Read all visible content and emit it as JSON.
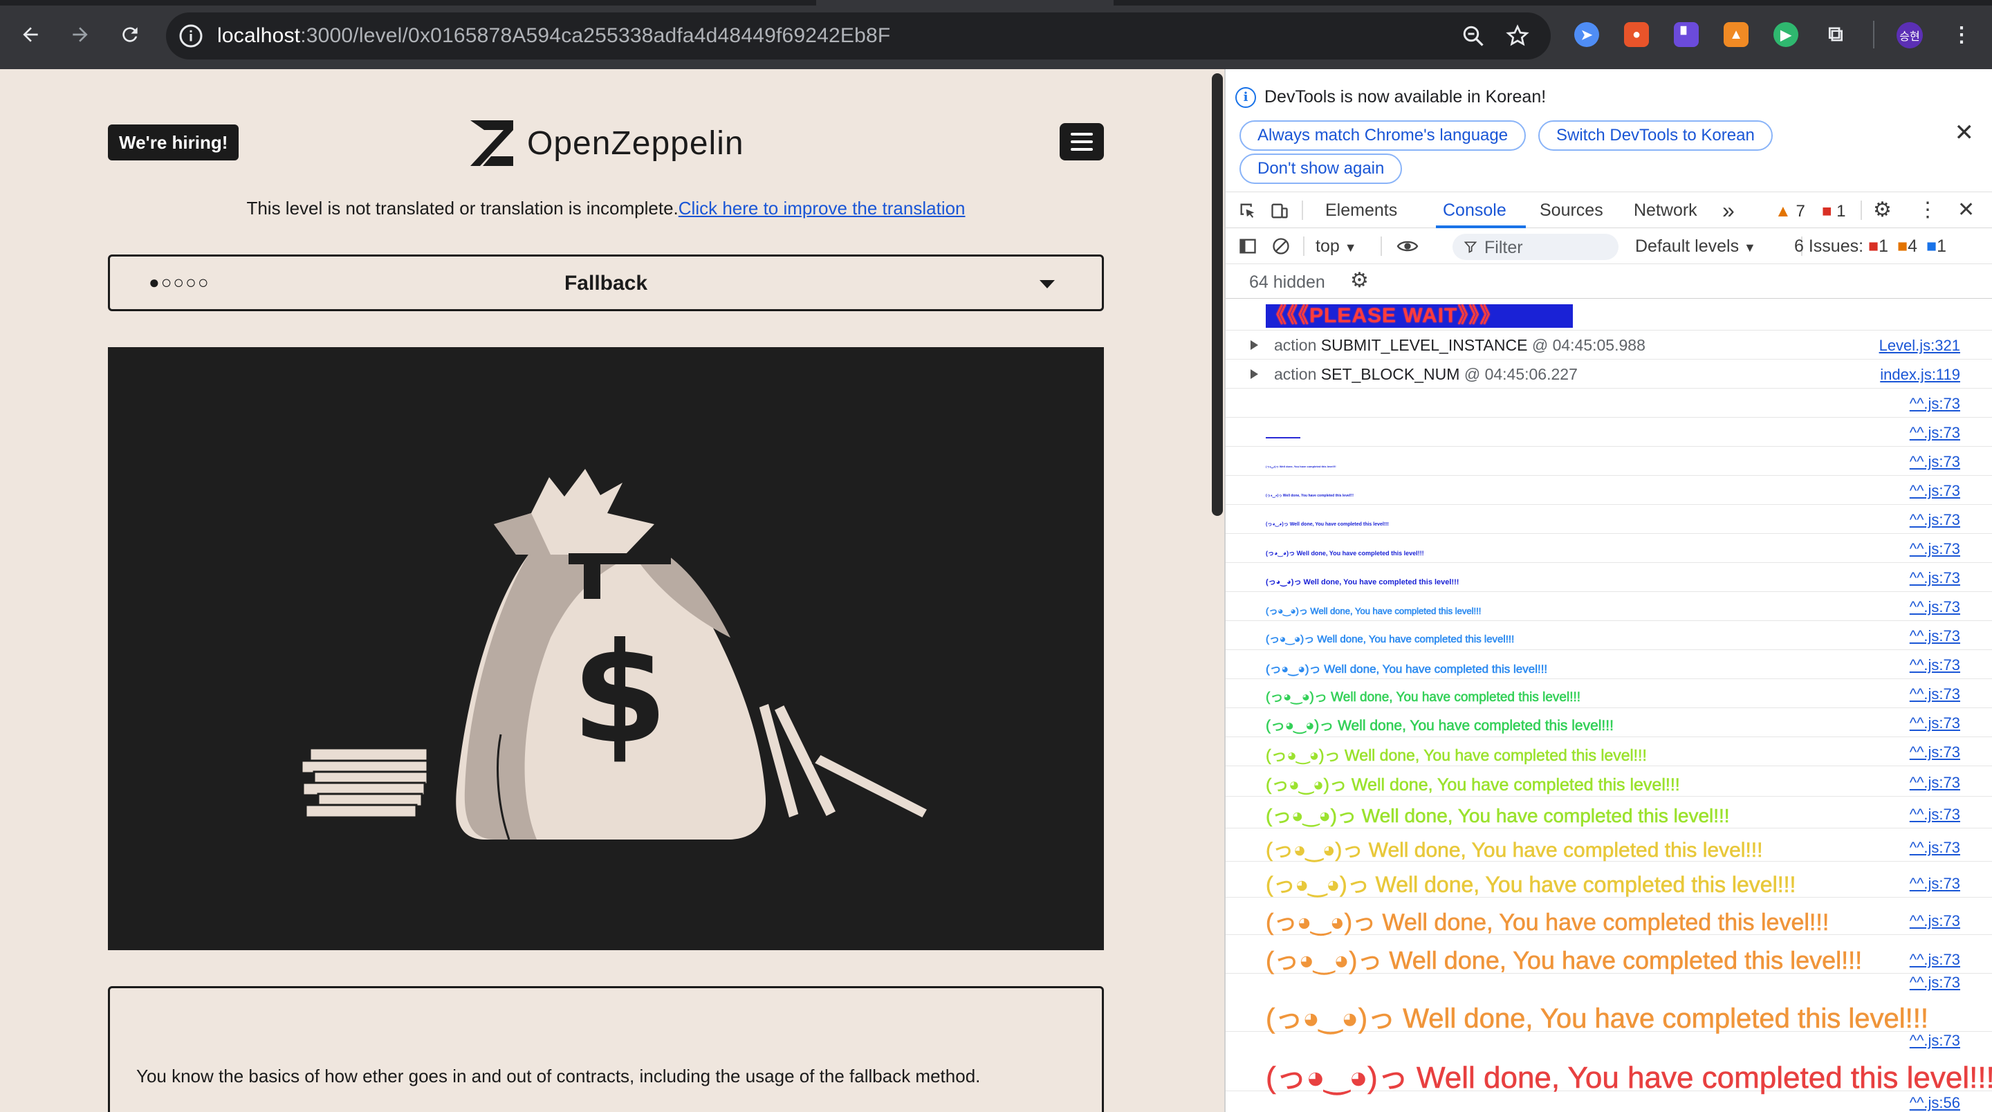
{
  "browser": {
    "url_host": "localhost",
    "url_path": ":3000/level/0x0165878A594ca255338adfa4d48449f69242Eb8F",
    "profile_initials": "승현",
    "extensions": [
      {
        "name": "compass-icon",
        "color": "#4f8df5"
      },
      {
        "name": "pin-icon",
        "color": "#e8542a"
      },
      {
        "name": "bracket-icon",
        "color": "#6b4bdb"
      },
      {
        "name": "fox-icon",
        "color": "#f08a24"
      },
      {
        "name": "play-icon",
        "color": "#2fb86f"
      },
      {
        "name": "puzzle-icon",
        "color": "#dadce0"
      }
    ]
  },
  "page": {
    "hiring_badge": "We're hiring!",
    "brand": "OpenZeppelin",
    "translation_note": "This level is not translated or translation is incomplete.",
    "translation_link": "Click here to improve the translation",
    "level_dots": "●○○○○",
    "level_name": "Fallback",
    "description": "You know the basics of how ether goes in and out of contracts, including the usage of the fallback method."
  },
  "devtools": {
    "infobar": {
      "message": "DevTools is now available in Korean!",
      "btn_match": "Always match Chrome's language",
      "btn_switch": "Switch DevTools to Korean",
      "btn_dont": "Don't show again"
    },
    "tabs": {
      "elements": "Elements",
      "console": "Console",
      "sources": "Sources",
      "network": "Network",
      "more": "»",
      "warn_count": "7",
      "err_count": "1"
    },
    "toolbar": {
      "context": "top",
      "filter_placeholder": "Filter",
      "levels": "Default levels",
      "issues_label": "6 Issues:",
      "issues_err": "1",
      "issues_warn": "4",
      "issues_info": "1"
    },
    "hidden": "64 hidden",
    "console": {
      "wait_banner": "《《《PLEASE WAIT》》》",
      "actions": [
        {
          "name": "SUBMIT_LEVEL_INSTANCE",
          "time": "@ 04:45:05.988",
          "src": "Level.js:321",
          "prefix": "action"
        },
        {
          "name": "SET_BLOCK_NUM",
          "time": "@ 04:45:06.227",
          "src": "index.js:119",
          "prefix": "action"
        }
      ],
      "message": "(っ◕‿◕)っ Well done, You have completed this level!!!",
      "src_generic": "^^.js:73",
      "src_last": "^^.js:56",
      "colors": {
        "blue": "#1a22d6",
        "light_blue": "#2f8cf0",
        "green": "#34d058",
        "lime": "#9be22e",
        "yellow": "#e8c83a",
        "orange": "#f0953a",
        "red": "#e84040"
      }
    }
  }
}
